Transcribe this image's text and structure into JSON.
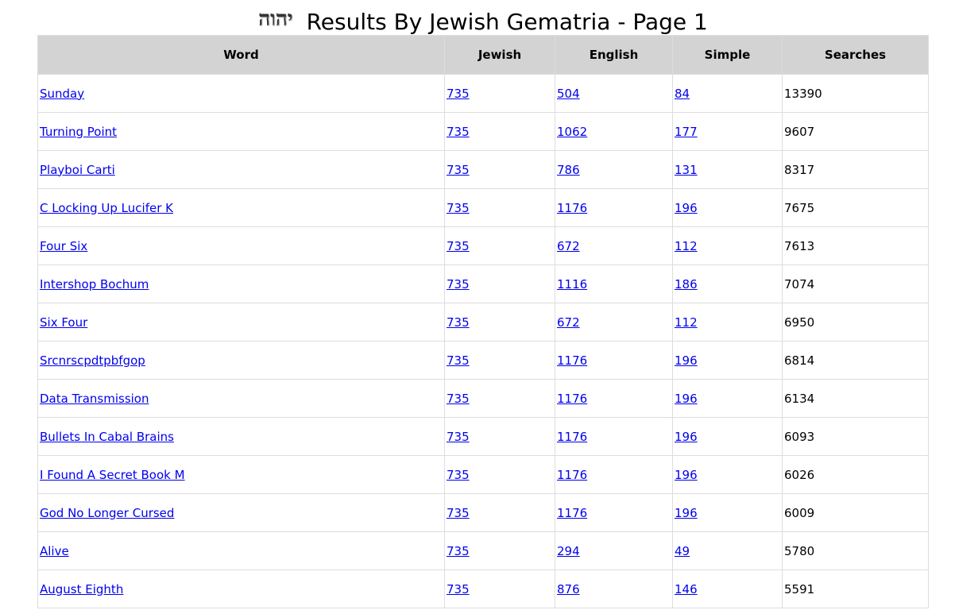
{
  "page": {
    "logo_text": "יהוה",
    "title": "Results By Jewish Gematria - Page 1"
  },
  "table": {
    "headers": {
      "word": "Word",
      "jewish": "Jewish",
      "english": "English",
      "simple": "Simple",
      "searches": "Searches"
    },
    "rows": [
      {
        "word": "Sunday",
        "jewish": "735",
        "english": "504",
        "simple": "84",
        "searches": "13390"
      },
      {
        "word": "Turning Point",
        "jewish": "735",
        "english": "1062",
        "simple": "177",
        "searches": "9607"
      },
      {
        "word": "Playboi Carti",
        "jewish": "735",
        "english": "786",
        "simple": "131",
        "searches": "8317"
      },
      {
        "word": "C Locking Up Lucifer K",
        "jewish": "735",
        "english": "1176",
        "simple": "196",
        "searches": "7675"
      },
      {
        "word": "Four Six",
        "jewish": "735",
        "english": "672",
        "simple": "112",
        "searches": "7613"
      },
      {
        "word": "Intershop Bochum",
        "jewish": "735",
        "english": "1116",
        "simple": "186",
        "searches": "7074"
      },
      {
        "word": "Six Four",
        "jewish": "735",
        "english": "672",
        "simple": "112",
        "searches": "6950"
      },
      {
        "word": "Srcnrscpdtpbfgop",
        "jewish": "735",
        "english": "1176",
        "simple": "196",
        "searches": "6814"
      },
      {
        "word": "Data Transmission",
        "jewish": "735",
        "english": "1176",
        "simple": "196",
        "searches": "6134"
      },
      {
        "word": "Bullets In Cabal Brains",
        "jewish": "735",
        "english": "1176",
        "simple": "196",
        "searches": "6093"
      },
      {
        "word": "I Found A Secret Book M",
        "jewish": "735",
        "english": "1176",
        "simple": "196",
        "searches": "6026"
      },
      {
        "word": "God No Longer Cursed",
        "jewish": "735",
        "english": "1176",
        "simple": "196",
        "searches": "6009"
      },
      {
        "word": "Alive",
        "jewish": "735",
        "english": "294",
        "simple": "49",
        "searches": "5780"
      },
      {
        "word": "August Eighth",
        "jewish": "735",
        "english": "876",
        "simple": "146",
        "searches": "5591"
      }
    ]
  }
}
